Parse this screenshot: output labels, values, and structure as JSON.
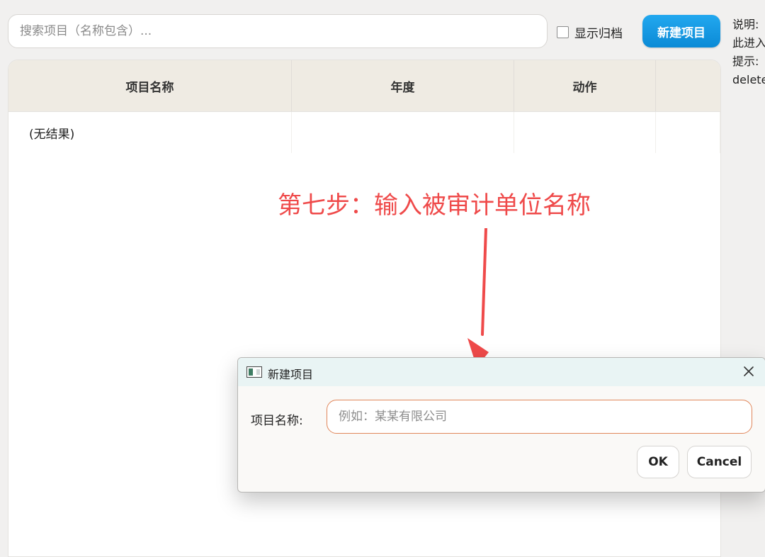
{
  "toolbar": {
    "search_placeholder": "搜索项目（名称包含）...",
    "archive_label": "显示归档",
    "new_project_label": "新建项目"
  },
  "side_note": {
    "lines": [
      "说明:",
      "此进入",
      "提示:",
      "delete"
    ]
  },
  "table": {
    "headers": [
      "项目名称",
      "年度",
      "动作",
      ""
    ],
    "empty_text": "(无结果)"
  },
  "annotation": {
    "text": "第七步：输入被审计单位名称",
    "color": "#ef4a4a"
  },
  "dialog": {
    "title": "新建项目",
    "field_label": "项目名称:",
    "field_placeholder": "例如：某某有限公司",
    "ok_label": "OK",
    "cancel_label": "Cancel"
  },
  "colors": {
    "accent": "#1499e3",
    "input_focus": "#e0865a",
    "header_bg": "#efebe3"
  }
}
